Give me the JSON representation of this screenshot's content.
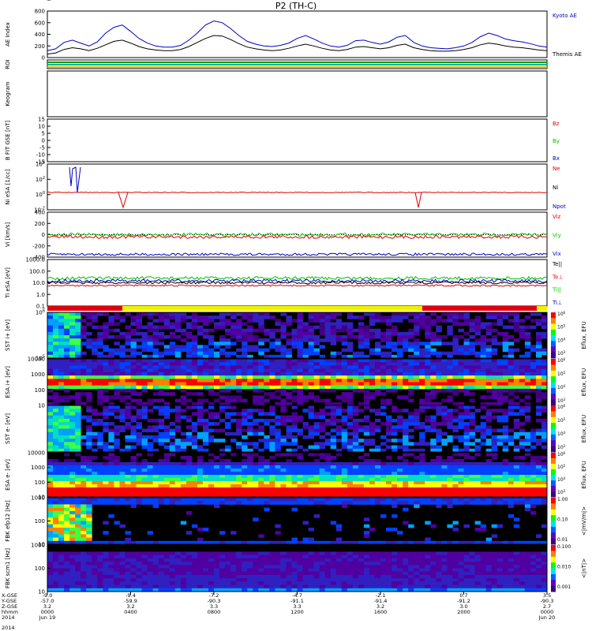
{
  "title": "P2 (TH-C)",
  "chart_data": {
    "type": "line",
    "title": "P2 (TH-C)",
    "date": "2014",
    "time_ticks": [
      {
        "x": "-9.0",
        "y": "-57.0",
        "z": "3.2",
        "hhmm": "0000",
        "date": "Jun 19"
      },
      {
        "x": "-9.4",
        "y": "-59.9",
        "z": "3.2",
        "hhmm": "0400",
        "date": ""
      },
      {
        "x": "-7.2",
        "y": "-90.3",
        "z": "3.3",
        "hhmm": "0800",
        "date": ""
      },
      {
        "x": "-4.7",
        "y": "-91.1",
        "z": "3.3",
        "hhmm": "1200",
        "date": ""
      },
      {
        "x": "-2.1",
        "y": "-91.4",
        "z": "3.2",
        "hhmm": "1600",
        "date": ""
      },
      {
        "x": "0.7",
        "y": "-91.2",
        "z": "3.0",
        "hhmm": "2000",
        "date": ""
      },
      {
        "x": "3.5",
        "y": "-90.3",
        "z": "2.7",
        "hhmm": "0000",
        "date": "Jun 20"
      }
    ],
    "x_row_labels": [
      "X-GSE",
      "Y-GSE",
      "Z-GSE",
      "hhmm",
      "2014"
    ],
    "panels": [
      {
        "id": "ae",
        "ylabel": "AE Index",
        "ylim": [
          0,
          800
        ],
        "ticks": [
          "0",
          "200",
          "400",
          "600",
          "800"
        ],
        "legend": [
          "Kyoto AE",
          "Themis AE"
        ],
        "colors": [
          "#0000c0",
          "#000000"
        ],
        "series": [
          {
            "name": "Kyoto AE",
            "values": [
              120,
              150,
              260,
              300,
              250,
              200,
              270,
              420,
              520,
              560,
              450,
              330,
              250,
              200,
              180,
              180,
              210,
              300,
              420,
              560,
              630,
              600,
              500,
              380,
              280,
              230,
              200,
              190,
              210,
              250,
              330,
              380,
              320,
              250,
              200,
              180,
              210,
              290,
              300,
              260,
              230,
              270,
              350,
              380,
              260,
              200,
              170,
              160,
              150,
              170,
              200,
              260,
              360,
              420,
              380,
              320,
              290,
              270,
              240,
              200,
              180
            ]
          },
          {
            "name": "Themis AE",
            "values": [
              60,
              80,
              140,
              170,
              150,
              120,
              160,
              220,
              280,
              300,
              250,
              190,
              150,
              130,
              120,
              120,
              140,
              190,
              260,
              330,
              380,
              370,
              310,
              240,
              180,
              150,
              130,
              120,
              130,
              160,
              200,
              230,
              200,
              160,
              130,
              120,
              140,
              180,
              190,
              170,
              150,
              170,
              210,
              230,
              170,
              140,
              120,
              110,
              110,
              120,
              140,
              170,
              220,
              250,
              230,
              200,
              180,
              170,
              150,
              130,
              120
            ]
          }
        ]
      },
      {
        "id": "roi",
        "ylabel": "ROI"
      },
      {
        "id": "keogram",
        "ylabel": "Keogram"
      },
      {
        "id": "bfit",
        "ylabel": "B FIT GSE [nT]",
        "ylim": [
          -15,
          15
        ],
        "ticks": [
          "-15",
          "-10",
          "-5",
          "0",
          "5",
          "10",
          "15"
        ],
        "legend": [
          "Bz",
          "By",
          "Bx"
        ],
        "colors": [
          "#e00000",
          "#00c000",
          "#0000e0"
        ]
      },
      {
        "id": "ni",
        "ylabel": "Ni eSA [1/cc]",
        "ticks": [
          "10<sup>-2</sup>",
          "10<sup>0</sup>",
          "10<sup>2</sup>",
          "10<sup>4</sup>"
        ],
        "legend": [
          "Ne",
          "Ni",
          "Npot"
        ],
        "colors": [
          "#e00000",
          "#000000",
          "#0000c0"
        ]
      },
      {
        "id": "vi",
        "ylabel": "Vi [km/s]",
        "ylim": [
          -400,
          400
        ],
        "ticks": [
          "-400",
          "-200",
          "0",
          "200",
          "400"
        ],
        "legend": [
          "Viz",
          "Viy",
          "Vix"
        ],
        "colors": [
          "#e00000",
          "#00c000",
          "#0000c0"
        ]
      },
      {
        "id": "ti",
        "ylabel": "Ti eSA [eV]",
        "ticks": [
          "0.1",
          "1.0",
          "10.0",
          "100.0",
          "1000.0"
        ],
        "legend": [
          "Te||",
          "Te⊥",
          "Ti||",
          "Ti⊥"
        ],
        "colors": [
          "#000000",
          "#e00000",
          "#00c000",
          "#0000c0"
        ]
      },
      {
        "id": "sst_i",
        "ylabel": "SST i+ [eV]",
        "ticks": [
          "10<sup>5</sup>",
          "10<sup>6</sup>"
        ],
        "cbar": "Eflux, EFU"
      },
      {
        "id": "esa_i",
        "ylabel": "ESA i+ [eV]",
        "ticks": [
          "10",
          "100",
          "1000",
          "10000"
        ],
        "cbar": "Eflux, EFU"
      },
      {
        "id": "sst_e",
        "ylabel": "SST e- [eV]",
        "ticks": [
          "10<sup>5</sup>"
        ],
        "cbar": "Eflux, EFU"
      },
      {
        "id": "esa_e",
        "ylabel": "ESA e- [eV]",
        "ticks": [
          "10",
          "100",
          "1000",
          "10000"
        ],
        "cbar": "Eflux, EFU"
      },
      {
        "id": "fbk_e12",
        "ylabel": "FBK efp12 [Hz]",
        "ticks": [
          "10",
          "100",
          "1000"
        ],
        "cbar": "<|mV/m|>",
        "cbar_ticks": [
          "0.01",
          "0.10",
          "1.00"
        ]
      },
      {
        "id": "fbk_scm",
        "ylabel": "FBK scm1 [Hz]",
        "ticks": [
          "10",
          "100",
          "1000"
        ],
        "cbar": "<|nT|>",
        "cbar_ticks": [
          "0.001",
          "0.010",
          "0.100"
        ]
      }
    ],
    "cbar_ticks_eflux": [
      "10<sup>3</sup>",
      "10<sup>4</sup>",
      "10<sup>5</sup>",
      "10<sup>6</sup>",
      "10<sup>7</sup>",
      "10<sup>8</sup>"
    ]
  }
}
